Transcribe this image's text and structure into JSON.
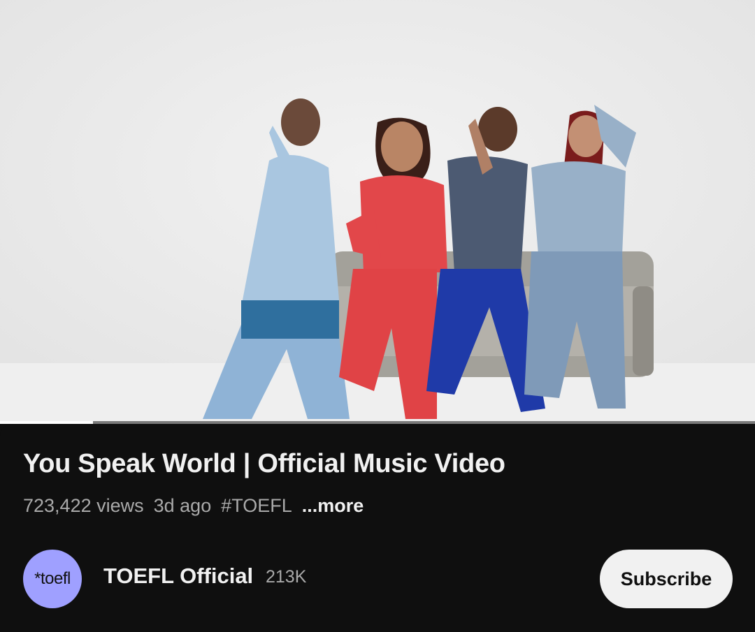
{
  "player": {
    "progress_fraction": 0.123
  },
  "video": {
    "title": "You Speak World | Official Music Video",
    "views": "723,422 views",
    "age": "3d ago",
    "hashtag": "#TOEFL",
    "more_label": "...more"
  },
  "channel": {
    "avatar_text": "*toefl",
    "name": "TOEFL Official",
    "subscribers": "213K",
    "subscribe_label": "Subscribe"
  },
  "colors": {
    "background": "#0f0f0f",
    "avatar": "#9fa0ff",
    "subscribe_button": "#f1f1f1",
    "secondary_text": "#aaaaaa"
  }
}
